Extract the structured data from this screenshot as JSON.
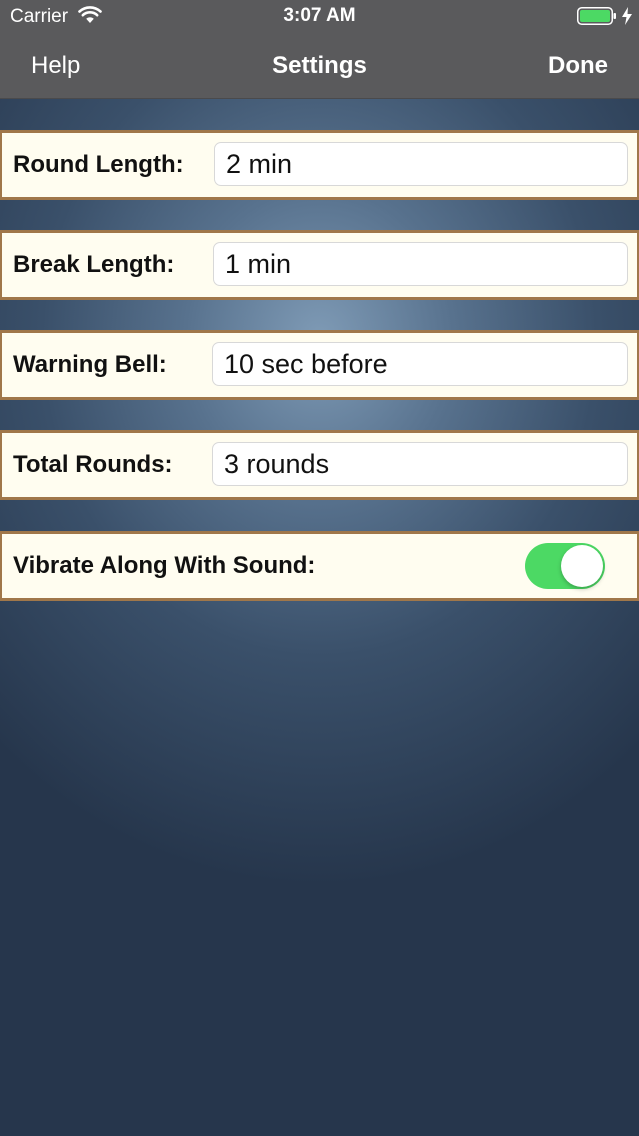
{
  "status_bar": {
    "carrier": "Carrier",
    "time": "3:07 AM",
    "icons": [
      "wifi-icon",
      "battery-icon",
      "charging-icon"
    ]
  },
  "nav": {
    "left": "Help",
    "title": "Settings",
    "right": "Done"
  },
  "settings": {
    "round_length": {
      "label": "Round Length:",
      "value": "2 min"
    },
    "break_length": {
      "label": "Break Length:",
      "value": "1 min"
    },
    "warning_bell": {
      "label": "Warning Bell:",
      "value": "10 sec before"
    },
    "total_rounds": {
      "label": "Total Rounds:",
      "value": "3 rounds"
    },
    "vibrate": {
      "label": "Vibrate Along With Sound:",
      "on": true
    }
  },
  "colors": {
    "nav_background": "#5a5a5c",
    "row_background": "#fffdf0",
    "row_border": "#a0774a",
    "toggle_on": "#4cd964",
    "battery": "#4cd964"
  }
}
